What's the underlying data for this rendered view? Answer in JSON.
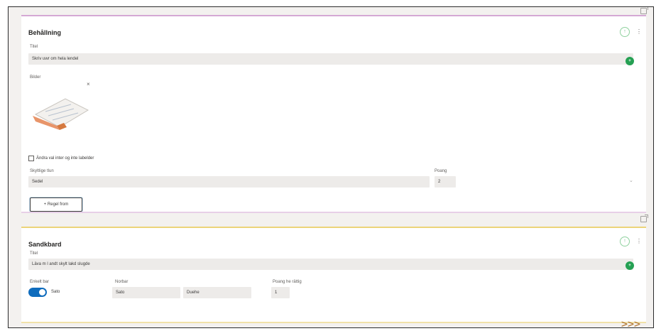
{
  "card1": {
    "title": "Behållning",
    "title_field_label": "Titel",
    "title_field_value": "Skriv uwr om hela lendel",
    "image_label": "Bilder",
    "image_close": "×",
    "checkbox_label": "Ändra val inter og inte labelder",
    "type_label": "Skyltlige tlun",
    "type_value": "Sedel",
    "points_label": "Poang",
    "points_value": "2",
    "chevron": "⌄",
    "add_button": "+ Regel from",
    "circle_label": "↑",
    "more": "⋮",
    "dot": "+"
  },
  "card2": {
    "title": "Sandkbard",
    "title_field_label": "Titel",
    "title_field_value": "Läva m l andt skylt lakd slugde",
    "toggle_label": "Enkelt bar",
    "toggle_state": "Sato",
    "values_label": "Norbar",
    "value_a": "Sato",
    "value_b": "Duehe",
    "pvv_label": "Poang he rättig",
    "pvv_value": "1",
    "circle_label": "↑",
    "more": "⋮",
    "dot": "+"
  },
  "nav": {
    "next": ">>>"
  },
  "colors": {
    "card1_accent": "#d4a8d4",
    "card2_accent": "#ecd479",
    "toggle_on": "#0f6cbd",
    "green": "#25a053",
    "nav_arrows": "#b0732c"
  }
}
